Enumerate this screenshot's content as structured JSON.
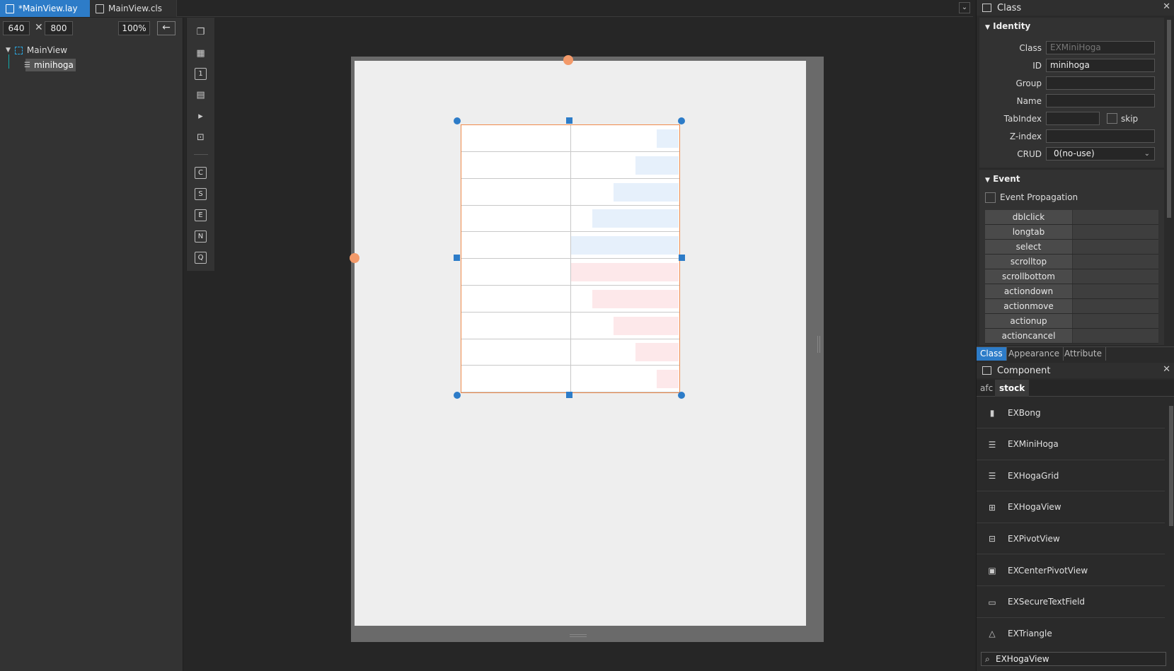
{
  "tabs": [
    {
      "label": "*MainView.lay",
      "active": true
    },
    {
      "label": "MainView.cls",
      "active": false
    }
  ],
  "size": {
    "width": "640",
    "height": "800",
    "times": "✕",
    "zoom": "100%",
    "back": "←"
  },
  "tree": {
    "root": "MainView",
    "child": "minihoga"
  },
  "toolbar": {
    "letters": [
      "C",
      "S",
      "E",
      "N",
      "Q"
    ]
  },
  "hoga": {
    "rows": 10,
    "ask_color": "#e6f0fb",
    "bid_color": "#fde8ea",
    "ask_levels": [
      0.2,
      0.4,
      0.6,
      0.8,
      1.0
    ],
    "bid_levels": [
      1.0,
      0.8,
      0.6,
      0.4,
      0.2
    ]
  },
  "panel": {
    "title": "Class",
    "identity": {
      "header": "Identity",
      "fields": [
        {
          "label": "Class",
          "value": "EXMiniHoga",
          "disabled": true
        },
        {
          "label": "ID",
          "value": "minihoga"
        },
        {
          "label": "Group",
          "value": ""
        },
        {
          "label": "Name",
          "value": ""
        },
        {
          "label": "TabIndex",
          "value": ""
        },
        {
          "label": "Z-index",
          "value": ""
        },
        {
          "label": "CRUD",
          "value": "0(no-use)"
        }
      ],
      "skip": "skip"
    },
    "event": {
      "header": "Event",
      "propagation": "Event Propagation",
      "events": [
        "dblclick",
        "longtab",
        "select",
        "scrolltop",
        "scrollbottom",
        "actiondown",
        "actionmove",
        "actionup",
        "actioncancel"
      ]
    },
    "tabs": [
      "Class",
      "Appearance",
      "Attribute"
    ]
  },
  "component": {
    "title": "Component",
    "tabs": [
      "afc",
      "stock"
    ],
    "items": [
      {
        "label": "EXBong",
        "icon": "▮"
      },
      {
        "label": "EXMiniHoga",
        "icon": "☰"
      },
      {
        "label": "EXHogaGrid",
        "icon": "☰"
      },
      {
        "label": "EXHogaView",
        "icon": "⊞"
      },
      {
        "label": "EXPivotView",
        "icon": "⊟"
      },
      {
        "label": "EXCenterPivotView",
        "icon": "▣"
      },
      {
        "label": "EXSecureTextField",
        "icon": "▭"
      },
      {
        "label": "EXTriangle",
        "icon": "△"
      }
    ],
    "search": "EXHogaView"
  }
}
